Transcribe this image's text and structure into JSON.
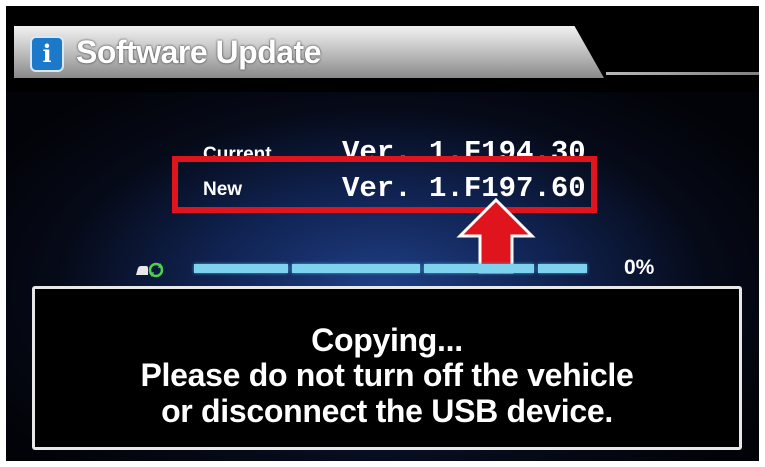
{
  "header": {
    "icon": "info-icon",
    "title": "Software Update"
  },
  "versions": {
    "current": {
      "label": "Current",
      "value": "Ver. 1.F194.30"
    },
    "new": {
      "label": "New",
      "value": "Ver. 1.F197.60"
    }
  },
  "annotation": {
    "highlight_color": "#e0141c",
    "arrow_color": "#e0141c",
    "arrow_icon": "arrow-up-icon"
  },
  "progress": {
    "icon": "usb-sync-icon",
    "percent_label": "0%",
    "fraction": 0.0,
    "bar_color": "#7fd2ee"
  },
  "message": {
    "line1": "Copying...",
    "line2": "Please do not turn off the vehicle",
    "line3": "or disconnect the USB device."
  }
}
